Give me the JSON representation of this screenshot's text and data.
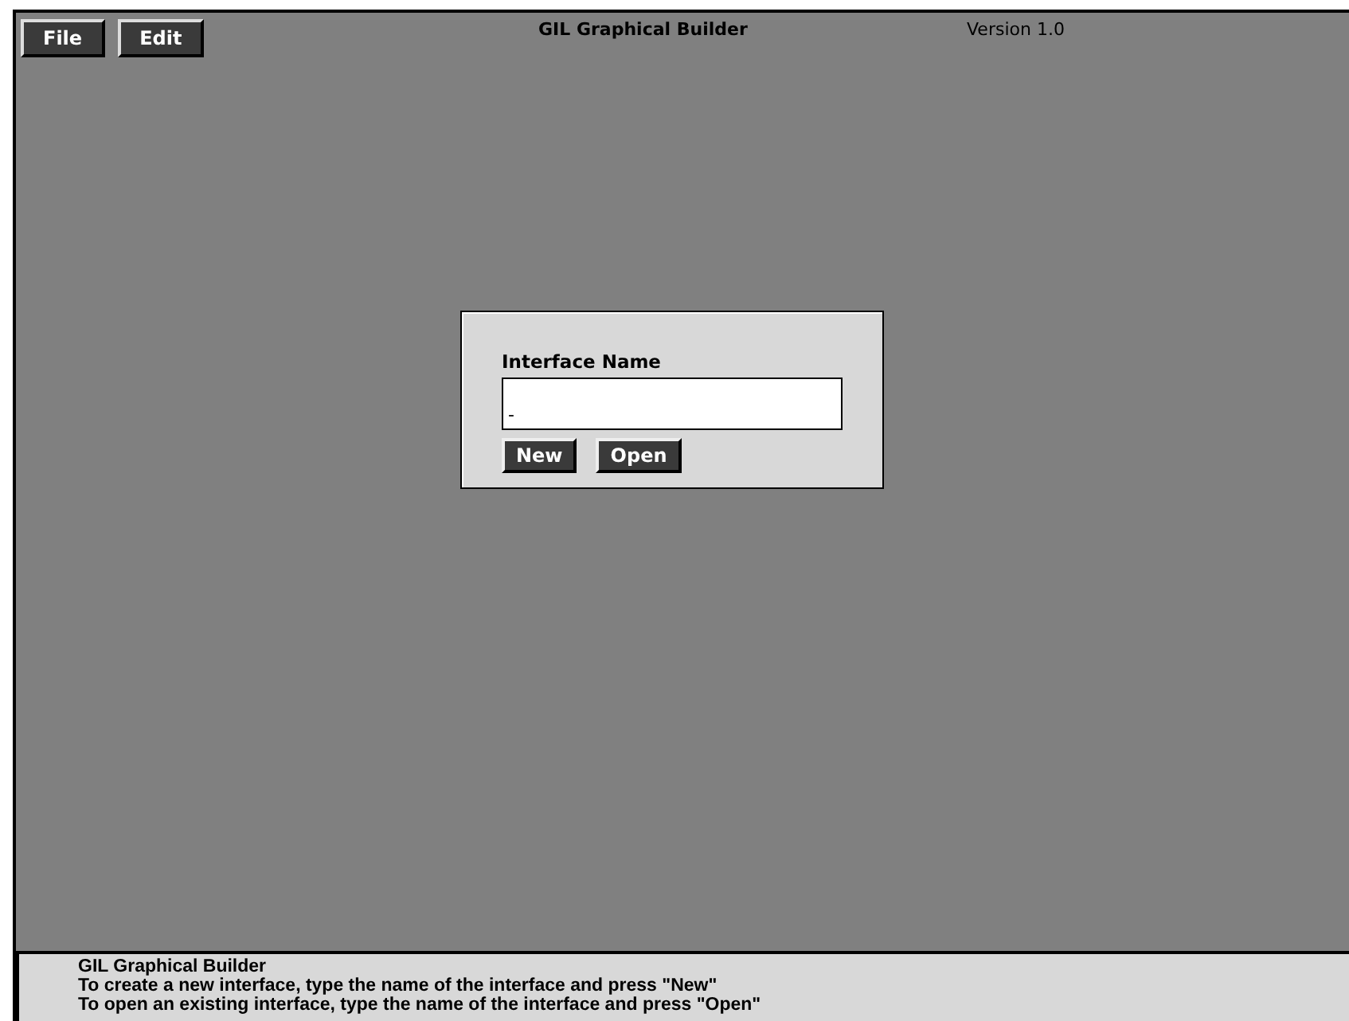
{
  "menu": [
    {
      "label": "File"
    },
    {
      "label": "Edit"
    }
  ],
  "window": {
    "title": "GIL Graphical Builder",
    "version": "Version 1.0"
  },
  "dialog": {
    "label": "Interface Name",
    "value": "-",
    "buttons": [
      {
        "label": "New"
      },
      {
        "label": "Open"
      }
    ]
  },
  "status_bar": {
    "lines": [
      "GIL Graphical Builder",
      "To create a new interface, type the name of the interface and press \"New\"",
      "To open an existing interface, type the name of the interface and press \"Open\""
    ]
  }
}
